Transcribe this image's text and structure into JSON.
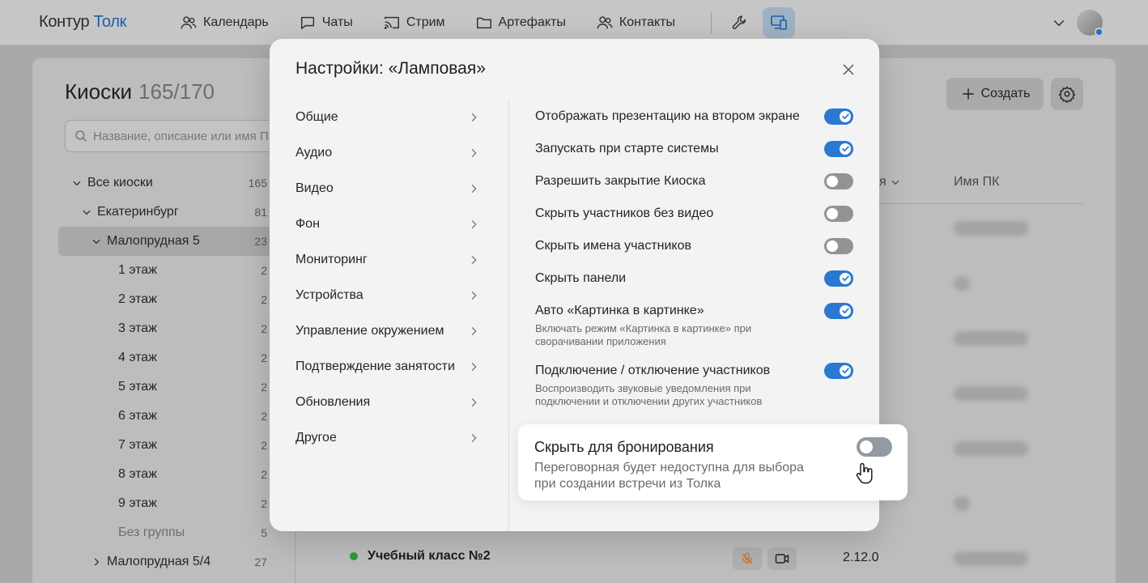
{
  "topbar": {
    "logo_part1": "Контур",
    "logo_part2": "Толк",
    "nav": [
      {
        "label": "Календарь",
        "icon": "people-icon"
      },
      {
        "label": "Чаты",
        "icon": "chat-icon"
      },
      {
        "label": "Стрим",
        "icon": "stream-icon"
      },
      {
        "label": "Артефакты",
        "icon": "folder-icon"
      },
      {
        "label": "Контакты",
        "icon": "contacts-icon"
      }
    ]
  },
  "page": {
    "title": "Киоски",
    "count": "165/170",
    "search_placeholder": "Название, описание или имя ПК",
    "create_label": "Создать",
    "columns": {
      "version_suffix": "я",
      "pc_name": "Имя ПК"
    },
    "tree": [
      {
        "label": "Все киоски",
        "count": "165"
      },
      {
        "label": "Екатеринбург",
        "count": "81"
      },
      {
        "label": "Малопрудная 5",
        "count": "23"
      },
      {
        "label": "1 этаж",
        "count": "2"
      },
      {
        "label": "2 этаж",
        "count": "2"
      },
      {
        "label": "3 этаж",
        "count": "2"
      },
      {
        "label": "4 этаж",
        "count": "2"
      },
      {
        "label": "5 этаж",
        "count": "2"
      },
      {
        "label": "6 этаж",
        "count": "2"
      },
      {
        "label": "7 этаж",
        "count": "2"
      },
      {
        "label": "8 этаж",
        "count": "2"
      },
      {
        "label": "9 этаж",
        "count": "2"
      },
      {
        "label": "Без группы",
        "count": "5"
      },
      {
        "label": "Малопрудная 5/4",
        "count": "27"
      }
    ],
    "bottom_row": {
      "name": "Учебный класс №2",
      "version": "2.12.0"
    }
  },
  "modal": {
    "title": "Настройки: «Ламповая»",
    "menu": [
      "Общие",
      "Аудио",
      "Видео",
      "Фон",
      "Мониторинг",
      "Устройства",
      "Управление окружением",
      "Подтверждение занятости",
      "Обновления",
      "Другое"
    ],
    "options": [
      {
        "title": "Отображать презентацию на втором экране",
        "desc": "",
        "on": true
      },
      {
        "title": "Запускать при старте системы",
        "desc": "",
        "on": true
      },
      {
        "title": "Разрешить закрытие Киоска",
        "desc": "",
        "on": false
      },
      {
        "title": "Скрыть участников без видео",
        "desc": "",
        "on": false
      },
      {
        "title": "Скрыть имена участников",
        "desc": "",
        "on": false
      },
      {
        "title": "Скрыть панели",
        "desc": "",
        "on": true
      },
      {
        "title": "Авто «Картинка в картинке»",
        "desc": "Включать режим «Картинка в картинке» при сворачивании приложения",
        "on": true
      },
      {
        "title": "Подключение / отключение участников",
        "desc": "Воспроизводить звуковые уведомления при подключении и отключении других участников",
        "on": true
      }
    ],
    "highlight": {
      "title": "Скрыть для бронирования",
      "desc": "Переговорная будет недоступна для выбора при создании встречи из Толка",
      "on": false
    }
  },
  "colors": {
    "accent": "#2a78d2",
    "brand": "#1b5fa8",
    "status_online": "#2e9a3a"
  }
}
